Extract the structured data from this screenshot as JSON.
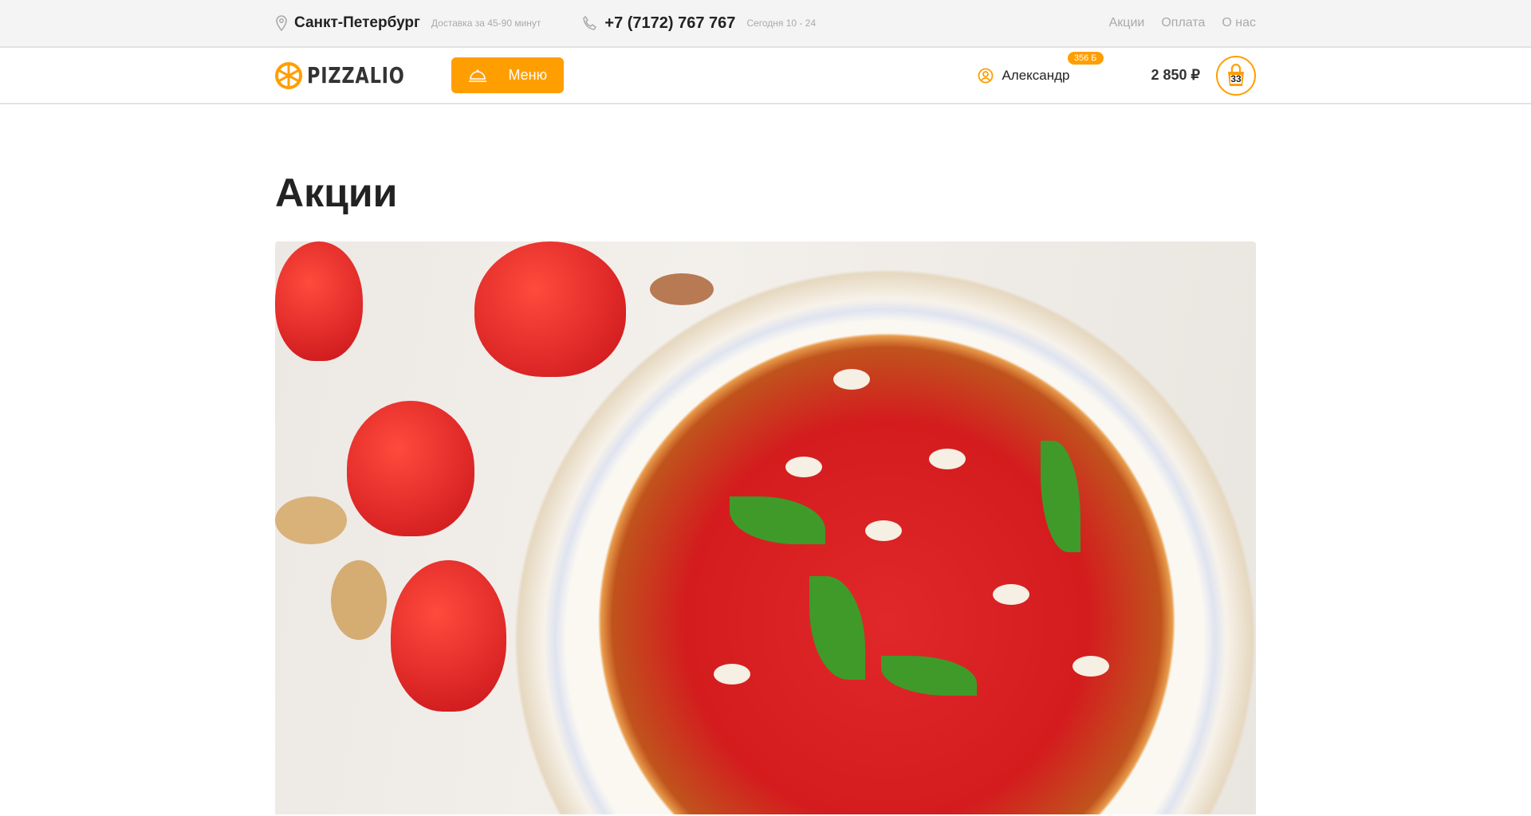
{
  "topbar": {
    "city": "Санкт-Петербург",
    "delivery": "Доставка за 45-90 минут",
    "phone": "+7 (7172) 767 767",
    "hours": "Сегодня 10 - 24",
    "links": [
      "Акции",
      "Оплата",
      "О нас"
    ]
  },
  "header": {
    "logo": "PIZZALIO",
    "menu_label": "Меню",
    "user_name": "Александр",
    "bonus": "356 Б",
    "cart_total": "2 850 ₽",
    "cart_count": "33"
  },
  "page": {
    "title": "Акции"
  },
  "colors": {
    "accent": "#ff9e00"
  }
}
